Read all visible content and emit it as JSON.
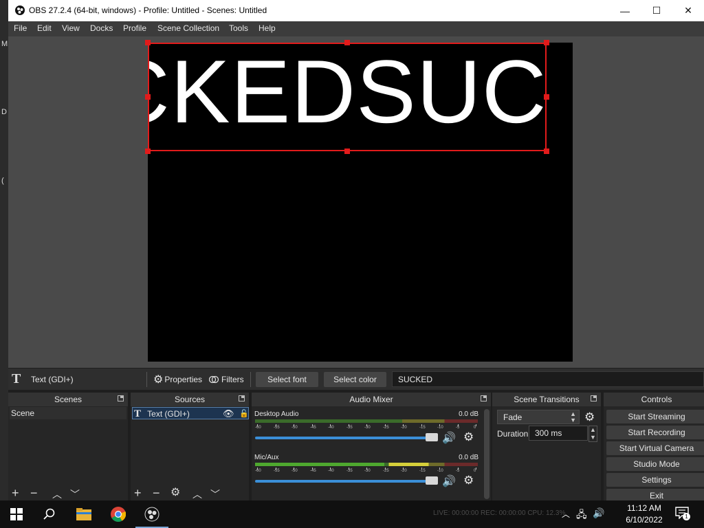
{
  "window": {
    "title": "OBS 27.2.4 (64-bit, windows) - Profile: Untitled - Scenes: Untitled",
    "minimize_glyph": "—",
    "maximize_glyph": "☐",
    "close_glyph": "✕"
  },
  "desktop_fragments": [
    "M",
    "D",
    "("
  ],
  "menu": [
    "File",
    "Edit",
    "View",
    "Docks",
    "Profile",
    "Scene Collection",
    "Tools",
    "Help"
  ],
  "preview": {
    "text_content": "CKEDSUC"
  },
  "context_bar": {
    "source_icon": "T",
    "source_name": "Text (GDI+)",
    "properties_label": "Properties",
    "filters_label": "Filters",
    "select_font_label": "Select font",
    "select_color_label": "Select color",
    "text_value": "SUCKED"
  },
  "scenes": {
    "title": "Scenes",
    "items": [
      "Scene"
    ]
  },
  "sources": {
    "title": "Sources",
    "items": [
      {
        "icon": "T",
        "name": "Text (GDI+)"
      }
    ]
  },
  "mixer": {
    "title": "Audio Mixer",
    "channels": [
      {
        "name": "Desktop Audio",
        "db": "0.0 dB",
        "level": 0.0
      },
      {
        "name": "Mic/Aux",
        "db": "0.0 dB",
        "level": 0.78
      }
    ],
    "ticks": [
      "-60",
      "-55",
      "-50",
      "-45",
      "-40",
      "-35",
      "-30",
      "-25",
      "-20",
      "-15",
      "-10",
      "-5",
      "0"
    ]
  },
  "transitions": {
    "title": "Scene Transitions",
    "selected": "Fade",
    "duration_label": "Duration",
    "duration_value": "300 ms"
  },
  "controls": {
    "title": "Controls",
    "buttons": [
      "Start Streaming",
      "Start Recording",
      "Start Virtual Camera",
      "Studio Mode",
      "Settings",
      "Exit"
    ]
  },
  "taskbar": {
    "status": "LIVE: 00:00:00   REC: 00:00:00   CPU: 12.3%",
    "time": "11:12 AM",
    "date": "6/10/2022",
    "notification_count": "1"
  },
  "colors": {
    "selection_red": "#e21b1b",
    "fader_blue": "#3b8fd8",
    "meter_green": "#4ea82f",
    "meter_yellow": "#d5cf3a"
  }
}
